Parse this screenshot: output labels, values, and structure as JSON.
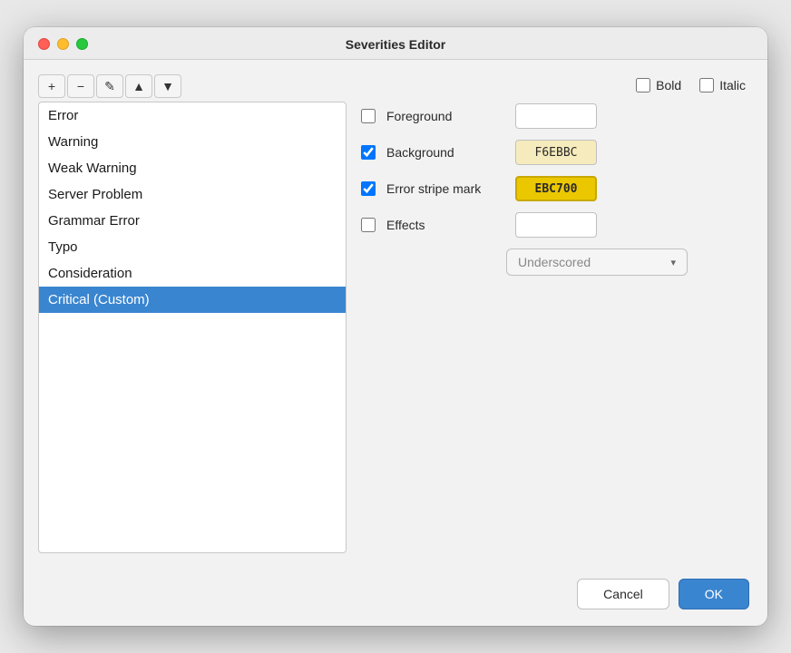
{
  "window": {
    "title": "Severities Editor"
  },
  "trafficLights": {
    "close": "close",
    "minimize": "minimize",
    "maximize": "maximize"
  },
  "toolbar": {
    "add": "+",
    "remove": "−",
    "edit": "✎",
    "moveUp": "▲",
    "moveDown": "▼"
  },
  "severityList": {
    "items": [
      {
        "label": "Error",
        "selected": false
      },
      {
        "label": "Warning",
        "selected": false
      },
      {
        "label": "Weak Warning",
        "selected": false
      },
      {
        "label": "Server Problem",
        "selected": false
      },
      {
        "label": "Grammar Error",
        "selected": false
      },
      {
        "label": "Typo",
        "selected": false
      },
      {
        "label": "Consideration",
        "selected": false
      },
      {
        "label": "Critical (Custom)",
        "selected": true
      }
    ]
  },
  "rightPanel": {
    "boldLabel": "Bold",
    "italicLabel": "Italic",
    "foregroundLabel": "Foreground",
    "backgroundLabel": "Background",
    "errorStripeLabel": "Error stripe mark",
    "effectsLabel": "Effects",
    "backgroundValue": "F6EBBC",
    "errorStripeValue": "EBC700",
    "effectsPlaceholder": "Underscored",
    "boldChecked": false,
    "italicChecked": false,
    "foregroundChecked": false,
    "backgroundChecked": true,
    "errorStripeChecked": true,
    "effectsChecked": false
  },
  "footer": {
    "cancelLabel": "Cancel",
    "okLabel": "OK"
  }
}
